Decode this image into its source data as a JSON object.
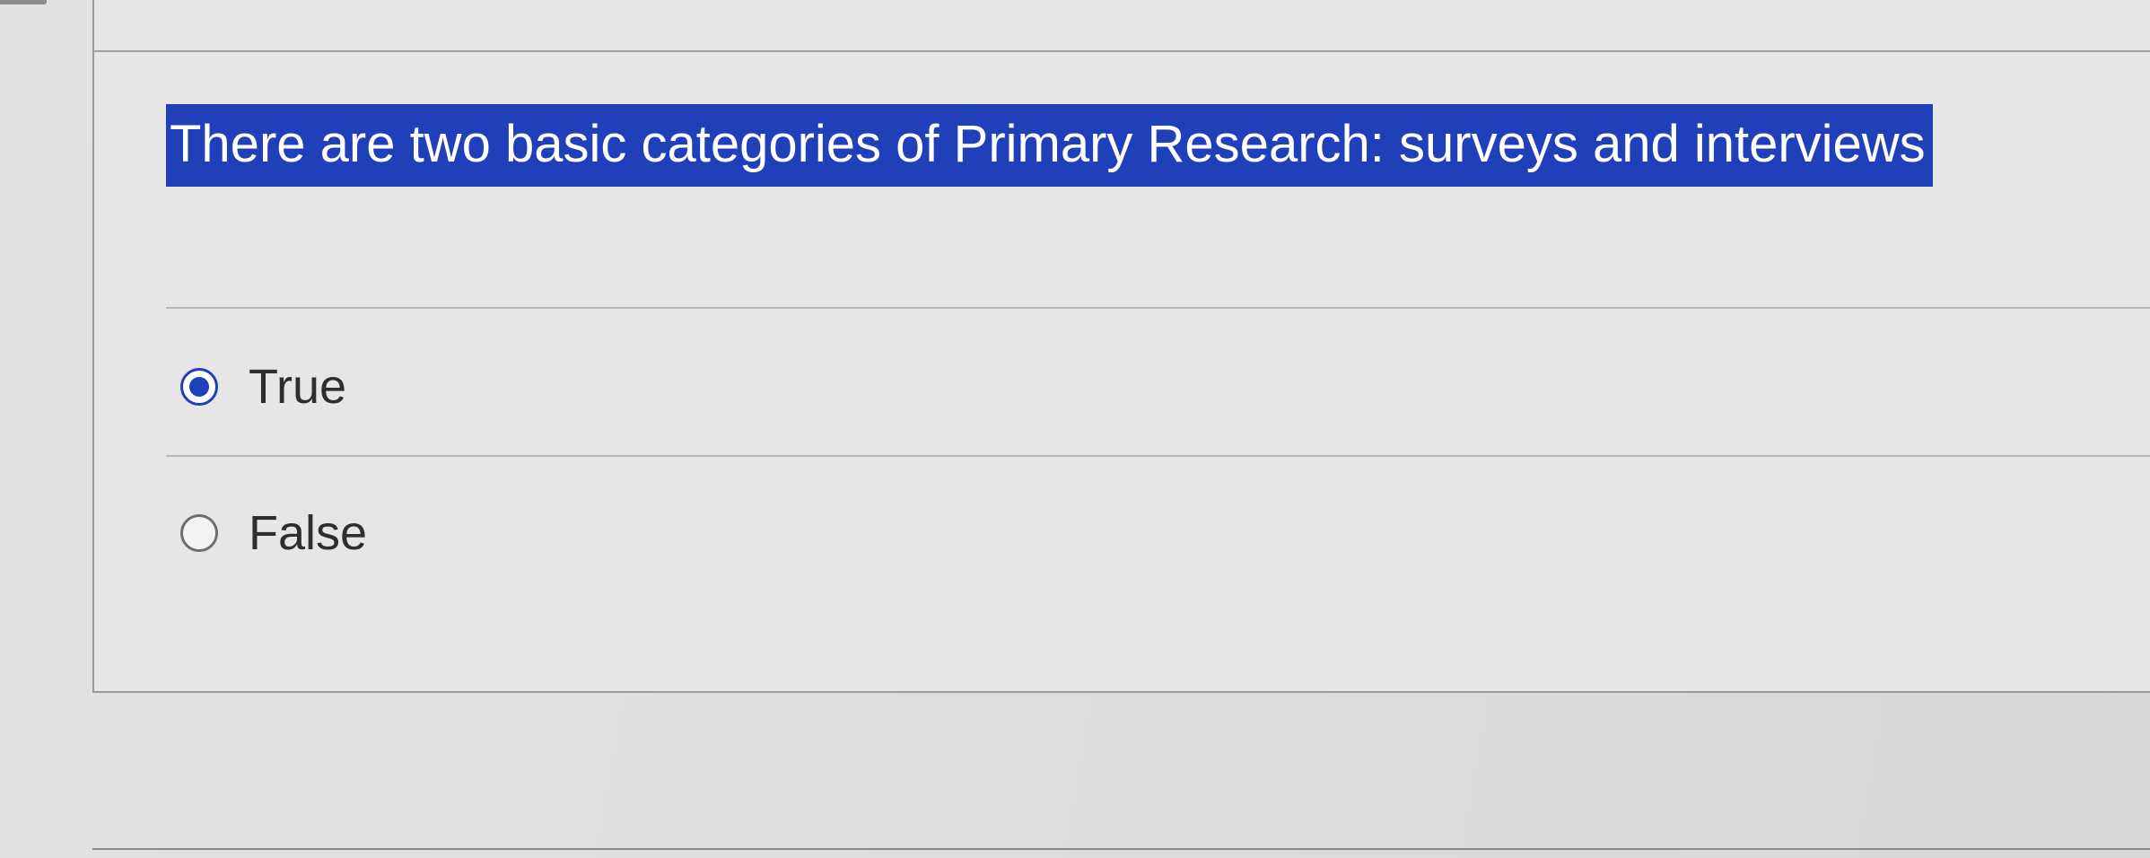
{
  "question": {
    "text": "There are two basic categories of Primary Research: surveys and interviews",
    "selected_value": "True",
    "options": [
      {
        "label": "True",
        "checked": true
      },
      {
        "label": "False",
        "checked": false
      }
    ]
  },
  "colors": {
    "highlight": "#1f40b8",
    "highlight_text": "#ffffff",
    "radio_selected": "#1f40b8",
    "background": "#dedede"
  }
}
